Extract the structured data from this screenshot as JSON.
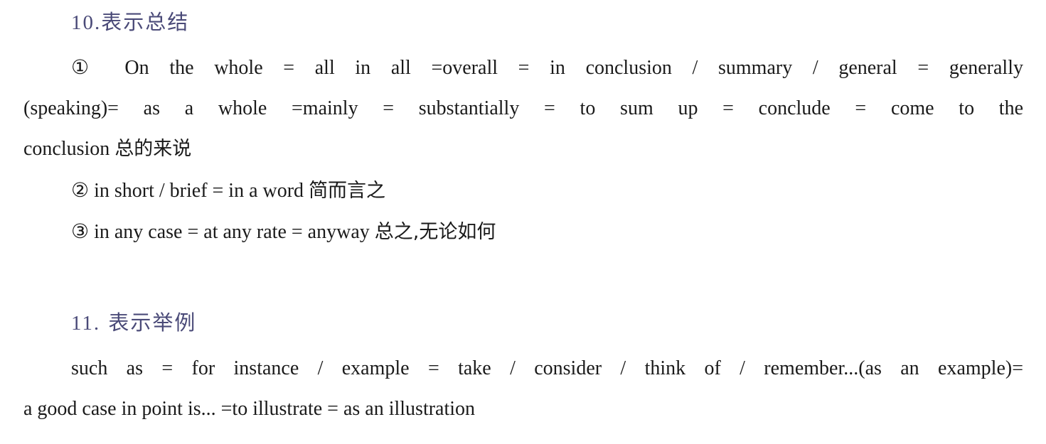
{
  "section10": {
    "title_num": "10.",
    "title_text": "表示总结",
    "item1": {
      "line1": "① On the whole = all in all =overall = in conclusion / summary / general = generally",
      "line2": "(speaking)= as a whole =mainly = substantially = to sum up = conclude = come to the",
      "line3_en": "conclusion",
      "line3_cn": "总的来说"
    },
    "item2": {
      "en": "② in short / brief = in a word",
      "cn": "简而言之"
    },
    "item3": {
      "en": "③ in any case = at any rate = anyway",
      "cn": "总之,无论如何"
    }
  },
  "section11": {
    "title_num": "11.",
    "title_text": "表示举例",
    "line1": "such as = for instance / example = take / consider / think of / remember...(as an example)=",
    "line2": "a good case in point is...  =to illustrate = as an illustration"
  }
}
